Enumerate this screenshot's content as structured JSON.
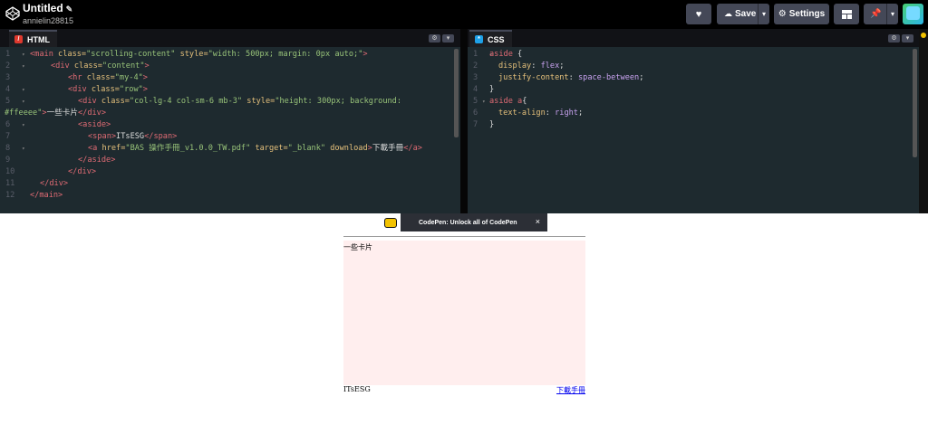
{
  "app": {
    "title": "Untitled",
    "user": "annielin28815",
    "buttons": {
      "save": "Save",
      "settings": "Settings"
    }
  },
  "html_editor": {
    "tab": "HTML",
    "lines": [
      {
        "n": "1",
        "fold": "▾"
      },
      {
        "n": "2",
        "fold": "▾"
      },
      {
        "n": "3",
        "fold": ""
      },
      {
        "n": "4",
        "fold": "▾"
      },
      {
        "n": "5",
        "fold": "▾"
      },
      {
        "n": "",
        "fold": ""
      },
      {
        "n": "6",
        "fold": "▾"
      },
      {
        "n": "7",
        "fold": ""
      },
      {
        "n": "8",
        "fold": "▾"
      },
      {
        "n": "9",
        "fold": ""
      },
      {
        "n": "10",
        "fold": ""
      },
      {
        "n": "11",
        "fold": ""
      },
      {
        "n": "12",
        "fold": ""
      }
    ],
    "code": {
      "l1_tag_open": "<main ",
      "l1_attr1": "class=",
      "l1_str1": "\"scrolling-content\"",
      "l1_attr2": " style=",
      "l1_str2": "\"width: 500px; margin: 0px auto;\"",
      "l1_tag_close": ">",
      "l2_tag_open": "<div ",
      "l2_attr": "class=",
      "l2_str": "\"content\"",
      "l2_tag_close": ">",
      "l3_tag_open": "<hr ",
      "l3_attr": "class=",
      "l3_str": "\"my-4\"",
      "l3_tag_close": ">",
      "l4_tag_open": "<div ",
      "l4_attr": "class=",
      "l4_str": "\"row\"",
      "l4_tag_close": ">",
      "l5_tag_open": "<div ",
      "l5_attr1": "class=",
      "l5_str1": "\"col-lg-4 col-sm-6 mb-3\"",
      "l5_attr2": " style=",
      "l5_str2": "\"height: 300px; background:",
      "l5b_str": "#ffeeee\"",
      "l5b_tag_close": ">",
      "l5b_text": "一些卡片",
      "l5b_tag_end": "</div>",
      "l6_tag": "<aside>",
      "l7_tag_open": "<span>",
      "l7_text": "ITsESG",
      "l7_tag_close": "</span>",
      "l8_tag_open": "<a ",
      "l8_attr1": "href=",
      "l8_str1": "\"BAS 操作手冊_v1.0.0_TW.pdf\"",
      "l8_attr2": " target=",
      "l8_str2": "\"_blank\"",
      "l8_attr3": " download",
      "l8_tag_close": ">",
      "l8_text": "下載手冊",
      "l8_tag_end": "</a>",
      "l9_tag": "</aside>",
      "l10_tag": "</div>",
      "l11_tag": "</div>",
      "l12_tag": "</main>"
    }
  },
  "css_editor": {
    "tab": "CSS",
    "lines": [
      {
        "n": "1",
        "fold": "▾"
      },
      {
        "n": "2",
        "fold": ""
      },
      {
        "n": "3",
        "fold": ""
      },
      {
        "n": "4",
        "fold": ""
      },
      {
        "n": "5",
        "fold": "▾"
      },
      {
        "n": "6",
        "fold": ""
      },
      {
        "n": "7",
        "fold": ""
      }
    ],
    "code": {
      "l1_sel": "aside",
      "l1_brace": " {",
      "l2_prop": "display",
      "l2_colon": ": ",
      "l2_val": "flex",
      "l2_semi": ";",
      "l3_prop": "justify-content",
      "l3_colon": ": ",
      "l3_val": "space-between",
      "l3_semi": ";",
      "l4_brace": "}",
      "l5_sel": "aside a",
      "l5_brace": "{",
      "l6_prop": "text-align",
      "l6_colon": ": ",
      "l6_val": "right",
      "l6_semi": ";",
      "l7_brace": "}"
    }
  },
  "promo": {
    "text": "CodePen: Unlock all of CodePen",
    "close": "×"
  },
  "preview": {
    "card_text": "一些卡片",
    "aside_span": "ITsESG",
    "aside_link": "下載手冊"
  },
  "colors": {
    "card_bg": "#ffeeee",
    "code_bg": "#1e2a2f",
    "topbar_bg": "#000000"
  }
}
